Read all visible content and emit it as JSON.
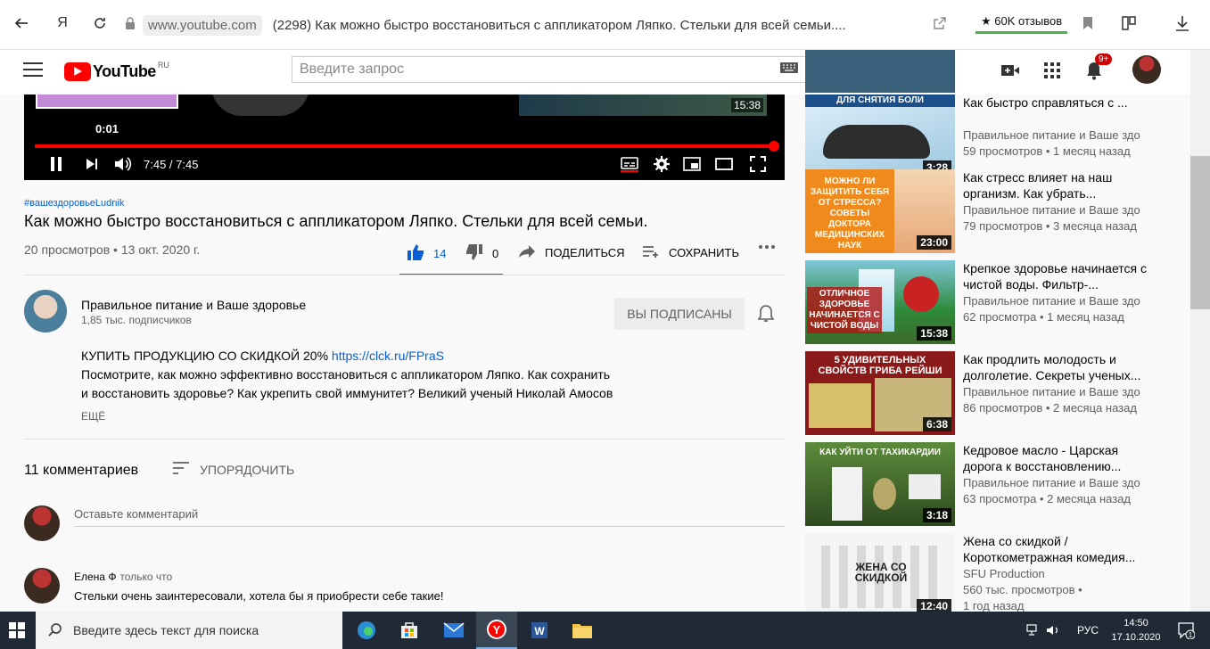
{
  "browser": {
    "url": "www.youtube.com",
    "tab_title": "(2298) Как можно быстро восстановиться с аппликатором Ляпко. Стельки для всей семьи....",
    "yandex_label": "Я",
    "reviews": "★ 60K отзывов"
  },
  "header": {
    "logo_text": "YouTube",
    "logo_country": "RU",
    "search_placeholder": "Введите запрос",
    "notifications_badge": "9+"
  },
  "player": {
    "preview_time": "0:01",
    "thumb_time": "15:38",
    "time_display": "7:45 / 7:45",
    "progress_fraction": 1.0
  },
  "video": {
    "hashtag": "#вашездоровьеLudnik",
    "title": "Как можно быстро восстановиться с аппликатором Ляпко. Стельки для всей семьи.",
    "meta": "20 просмотров • 13 окт. 2020 г.",
    "likes": "14",
    "dislikes": "0",
    "share_label": "ПОДЕЛИТЬСЯ",
    "save_label": "СОХРАНИТЬ"
  },
  "channel": {
    "name": "Правильное питание и Ваше здоровье",
    "subs": "1,85 тыс. подписчиков",
    "subscribed_label": "ВЫ ПОДПИСАНЫ"
  },
  "description": {
    "line1_prefix": "КУПИТЬ ПРОДУКЦИЮ СО СКИДКОЙ 20% ",
    "link": "https://clck.ru/FPraS",
    "line2": "Посмотрите, как можно эффективно восстановиться с аппликатором Ляпко. Как сохранить",
    "line3": "и восстановить здоровье? Как укрепить свой иммунитет? Великий ученый Николай Амосов",
    "more_label": "ЕЩЁ"
  },
  "comments": {
    "count": "11 комментариев",
    "sort_label": "УПОРЯДОЧИТЬ",
    "input_placeholder": "Оставьте комментарий",
    "items": [
      {
        "author": "Елена Ф",
        "time": "только что",
        "text": "Стельки очень заинтересовали, хотела бы я приобрести себе такие!"
      }
    ]
  },
  "sidebar": {
    "items": [
      {
        "title": "Как быстро справляться с ...",
        "channel": "Правильное питание и Ваше здо",
        "meta": "59 просмотров • 1 месяц назад",
        "duration": "3:28",
        "thumb_text": "ДЛЯ СНЯТИЯ БОЛИ",
        "thumb_colors": [
          "#cfe6f5",
          "#9cc7e0"
        ]
      },
      {
        "title": "Как стресс влияет на наш организм. Как убрать...",
        "channel": "Правильное питание и Ваше здо",
        "meta": "79 просмотров • 3 месяца назад",
        "duration": "23:00",
        "thumb_text": "МОЖНО ЛИ ЗАЩИТИТЬ СЕБЯ ОТ СТРЕССА? СОВЕТЫ ДОКТОРА МЕДИЦИНСКИХ НАУК",
        "thumb_colors": [
          "#f08a1c",
          "#f5c28a"
        ]
      },
      {
        "title": "Крепкое здоровье начинается с чистой воды. Фильтр-...",
        "channel": "Правильное питание и Ваше здо",
        "meta": "62 просмотра • 1 месяц назад",
        "duration": "15:38",
        "thumb_text": "ОТЛИЧНОЕ ЗДОРОВЬЕ НАЧИНАЕТСЯ С ЧИСТОЙ ВОДЫ",
        "thumb_colors": [
          "#2e8a3a",
          "#7ec6d8"
        ]
      },
      {
        "title": "Как продлить молодость и долголетие. Секреты ученых...",
        "channel": "Правильное питание и Ваше здо",
        "meta": "86 просмотров • 2 месяца назад",
        "duration": "6:38",
        "thumb_text": "5 УДИВИТЕЛЬНЫХ СВОЙСТВ ГРИБА РЕЙШИ",
        "thumb_colors": [
          "#8a1a1a",
          "#d8c06a"
        ]
      },
      {
        "title": "Кедровое масло - Царская дорога к восстановлению...",
        "channel": "Правильное питание и Ваше здо",
        "meta": "63 просмотра • 2 месяца назад",
        "duration": "3:18",
        "thumb_text": "КАК УЙТИ ОТ ТАХИКАРДИИ",
        "thumb_colors": [
          "#3a6a2a",
          "#c9e0b8"
        ]
      },
      {
        "title": "Жена со скидкой / Короткометражная комедия...",
        "channel": "SFU Production",
        "meta": "560 тыс. просмотров •",
        "meta2": "1 год назад",
        "duration": "12:40",
        "thumb_text": "ЖЕНА СО СКИДКОЙ",
        "thumb_colors": [
          "#f4f4f4",
          "#d8d8d8"
        ]
      }
    ]
  },
  "taskbar": {
    "search_placeholder": "Введите здесь текст для поиска",
    "lang": "РУС",
    "time": "14:50",
    "date": "17.10.2020",
    "notif_count": "1"
  }
}
